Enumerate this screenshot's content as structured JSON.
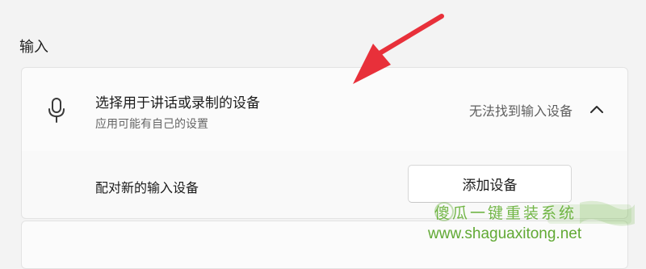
{
  "section": {
    "title": "输入"
  },
  "input_device": {
    "title": "选择用于讲话或录制的设备",
    "subtitle": "应用可能有自己的设置",
    "status": "无法找到输入设备",
    "icon": "microphone-icon",
    "expand_icon": "chevron-up-icon",
    "expanded": true
  },
  "pair": {
    "label": "配对新的输入设备",
    "button_label": "添加设备"
  },
  "watermark": {
    "name": "傻瓜一键重装系统",
    "url": "www.shaguaxitong.net",
    "color": "#5aaa28"
  },
  "annotation": {
    "arrow_color": "#e8303a"
  }
}
